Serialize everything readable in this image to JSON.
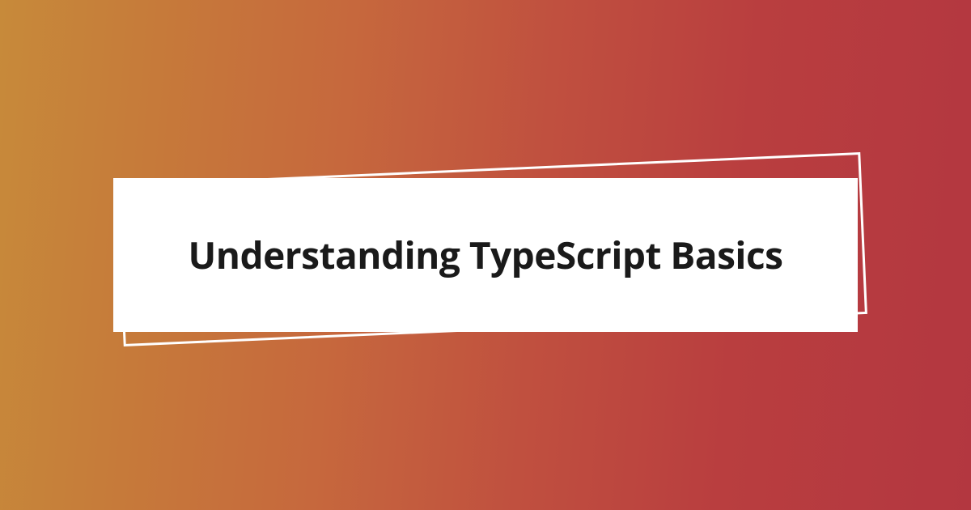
{
  "hero": {
    "title": "Understanding TypeScript Basics"
  }
}
